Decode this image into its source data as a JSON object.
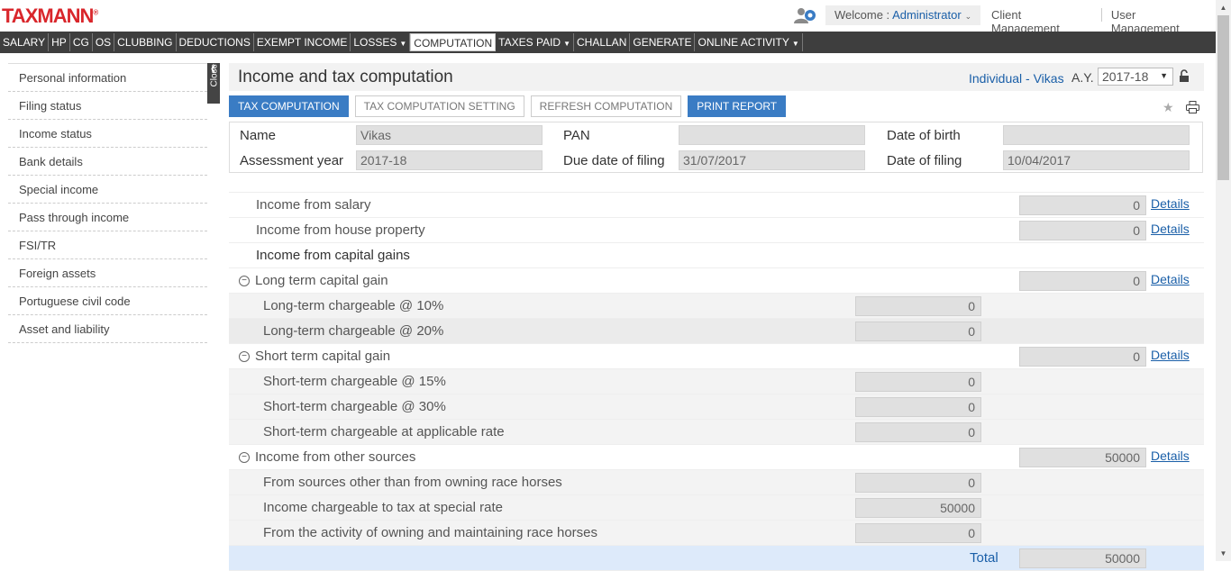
{
  "header": {
    "logo": "TAXMANN",
    "logo_reg": "®",
    "welcome_prefix": "Welcome :",
    "user": "Administrator",
    "links": [
      "Client Management",
      "User Management"
    ]
  },
  "nav": [
    {
      "label": "SALARY",
      "dropdown": false,
      "active": false
    },
    {
      "label": "HP",
      "dropdown": false,
      "active": false
    },
    {
      "label": "CG",
      "dropdown": false,
      "active": false
    },
    {
      "label": "OS",
      "dropdown": false,
      "active": false
    },
    {
      "label": "CLUBBING",
      "dropdown": false,
      "active": false
    },
    {
      "label": "DEDUCTIONS",
      "dropdown": false,
      "active": false
    },
    {
      "label": "EXEMPT INCOME",
      "dropdown": false,
      "active": false
    },
    {
      "label": "LOSSES",
      "dropdown": true,
      "active": false
    },
    {
      "label": "COMPUTATION",
      "dropdown": false,
      "active": true
    },
    {
      "label": "TAXES PAID",
      "dropdown": true,
      "active": false
    },
    {
      "label": "CHALLAN",
      "dropdown": false,
      "active": false
    },
    {
      "label": "GENERATE",
      "dropdown": false,
      "active": false
    },
    {
      "label": "ONLINE ACTIVITY",
      "dropdown": true,
      "active": false
    }
  ],
  "sidebar": {
    "close_label": "Close",
    "items": [
      "Personal information",
      "Filing status",
      "Income status",
      "Bank details",
      "Special income",
      "Pass through income",
      "FSI/TR",
      "Foreign assets",
      "Portuguese civil code",
      "Asset and liability"
    ]
  },
  "main": {
    "title": "Income and tax computation",
    "assessee": "Individual - Vikas",
    "ay_label": "A.Y.",
    "ay_value": "2017-18",
    "buttons": {
      "tax_computation": "TAX COMPUTATION",
      "tax_computation_setting": "TAX COMPUTATION SETTING",
      "refresh_computation": "REFRESH COMPUTATION",
      "print_report": "PRINT REPORT"
    },
    "info": {
      "name_label": "Name",
      "name_value": "Vikas",
      "pan_label": "PAN",
      "pan_value": "",
      "dob_label": "Date of birth",
      "dob_value": "",
      "ay_label": "Assessment year",
      "ay_value": "2017-18",
      "due_label": "Due date of filing",
      "due_value": "31/07/2017",
      "filing_label": "Date of filing",
      "filing_value": "10/04/2017"
    },
    "details_label": "Details",
    "income": {
      "salary": {
        "label": "Income from salary",
        "value": "0"
      },
      "house_property": {
        "label": "Income from house property",
        "value": "0"
      },
      "capital_gains": {
        "label": "Income from capital gains"
      },
      "ltcg": {
        "label": "Long term capital gain",
        "value": "0"
      },
      "ltcg10": {
        "label": "Long-term chargeable @ 10%",
        "value": "0"
      },
      "ltcg20": {
        "label": "Long-term chargeable @ 20%",
        "value": "0"
      },
      "stcg": {
        "label": "Short term capital gain",
        "value": "0"
      },
      "stcg15": {
        "label": "Short-term chargeable @ 15%",
        "value": "0"
      },
      "stcg30": {
        "label": "Short-term chargeable @ 30%",
        "value": "0"
      },
      "stcg_app": {
        "label": "Short-term chargeable at applicable rate",
        "value": "0"
      },
      "other": {
        "label": "Income from other sources",
        "value": "50000"
      },
      "other_non_race": {
        "label": "From sources other than from owning race horses",
        "value": "0"
      },
      "other_special": {
        "label": "Income chargeable to tax at special rate",
        "value": "50000"
      },
      "other_race": {
        "label": "From the activity of owning and maintaining race horses",
        "value": "0"
      },
      "total": {
        "label": "Total",
        "value": "50000"
      }
    }
  }
}
